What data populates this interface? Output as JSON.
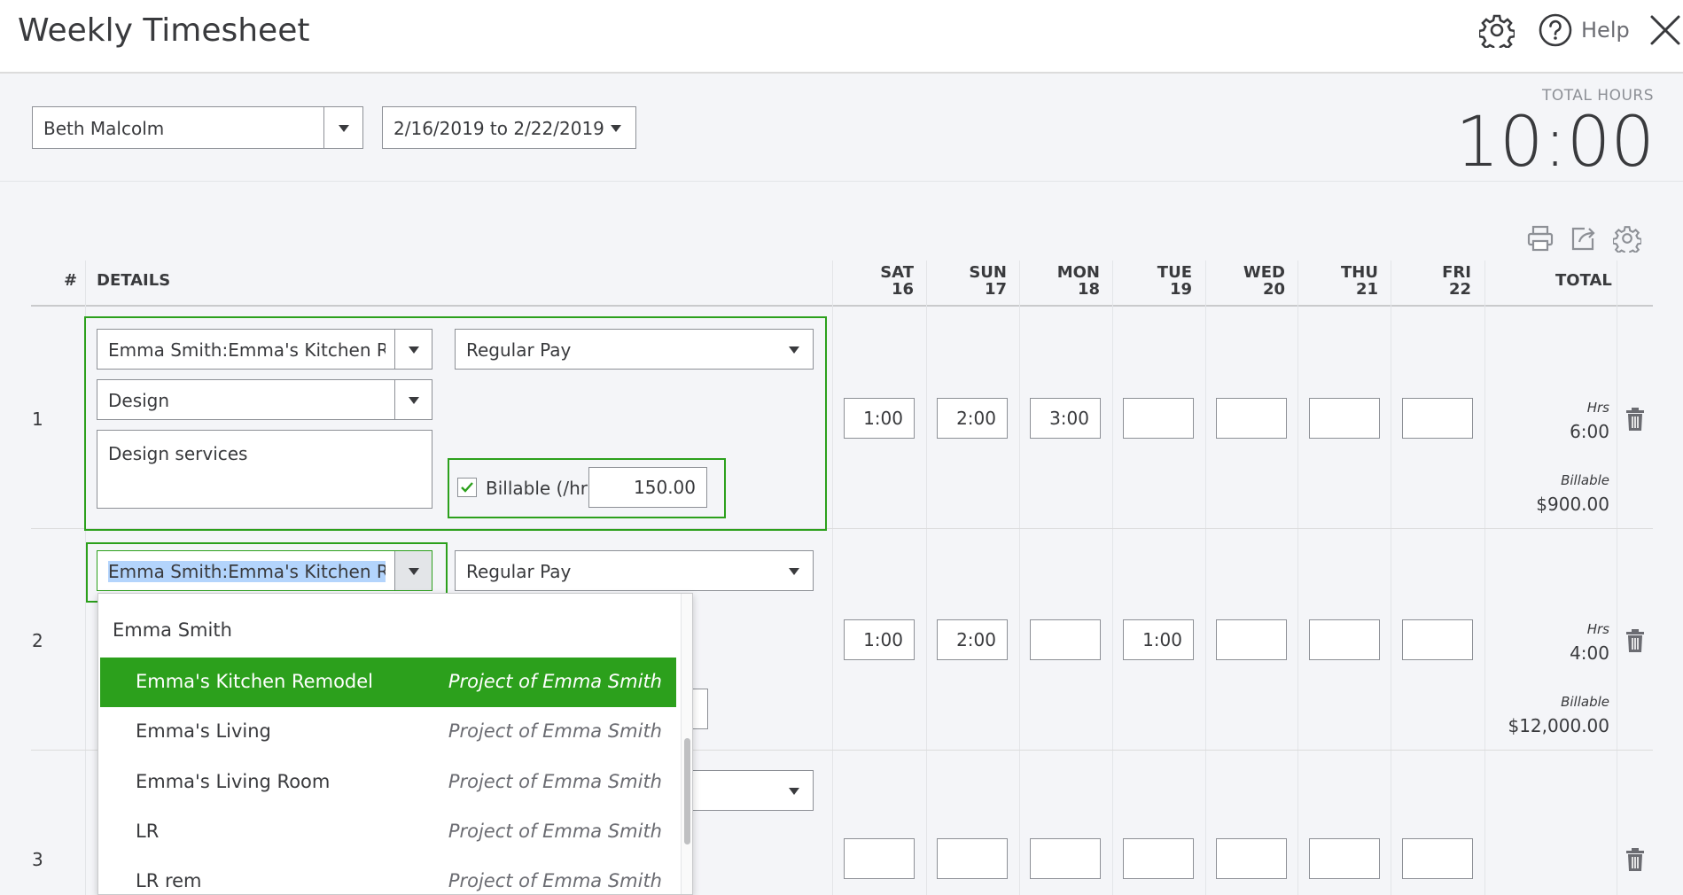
{
  "header": {
    "title": "Weekly Timesheet",
    "help_label": "Help"
  },
  "filters": {
    "employee": "Beth Malcolm",
    "date_range": "2/16/2019 to 2/22/2019"
  },
  "total_hours": {
    "label": "TOTAL HOURS",
    "value": "10:00"
  },
  "table": {
    "headers": {
      "num": "#",
      "details": "DETAILS",
      "total": "TOTAL"
    },
    "days": [
      {
        "dow": "SAT",
        "date": "16"
      },
      {
        "dow": "SUN",
        "date": "17"
      },
      {
        "dow": "MON",
        "date": "18"
      },
      {
        "dow": "TUE",
        "date": "19"
      },
      {
        "dow": "WED",
        "date": "20"
      },
      {
        "dow": "THU",
        "date": "21"
      },
      {
        "dow": "FRI",
        "date": "22"
      }
    ],
    "rows": [
      {
        "num": "1",
        "customer": "Emma Smith:Emma's Kitchen Remodel",
        "pay_type": "Regular Pay",
        "service": "Design",
        "description": "Design services",
        "billable_label": "Billable (/hr)",
        "rate": "150.00",
        "hours": [
          "1:00",
          "2:00",
          "3:00",
          "",
          "",
          "",
          ""
        ],
        "hrs_label": "Hrs",
        "total_hours": "6:00",
        "billable_total_label": "Billable",
        "billable_total": "$900.00"
      },
      {
        "num": "2",
        "customer": "Emma Smith:Emma's Kitchen Remodel",
        "pay_type": "Regular Pay",
        "hours": [
          "1:00",
          "2:00",
          "",
          "1:00",
          "",
          "",
          ""
        ],
        "hrs_label": "Hrs",
        "total_hours": "4:00",
        "billable_total_label": "Billable",
        "billable_total": "$12,000.00"
      },
      {
        "num": "3",
        "hours": [
          "",
          "",
          "",
          "",
          "",
          "",
          ""
        ]
      }
    ]
  },
  "dropdown": {
    "group_header": "Emma Smith",
    "items": [
      {
        "name": "Emma's Kitchen Remodel",
        "desc": "Project of Emma Smith",
        "active": true
      },
      {
        "name": "Emma's Living",
        "desc": "Project of Emma Smith",
        "active": false
      },
      {
        "name": "Emma's Living Room",
        "desc": "Project of Emma Smith",
        "active": false
      },
      {
        "name": "LR",
        "desc": "Project of Emma Smith",
        "active": false
      },
      {
        "name": "LR rem",
        "desc": "Project of Emma Smith",
        "active": false
      }
    ]
  },
  "colors": {
    "accent_green": "#2ca01c",
    "text": "#393a3d",
    "selection": "#b3d4fc"
  },
  "icons": [
    "gear-icon",
    "help-icon",
    "close-icon",
    "print-icon",
    "export-icon",
    "settings-icon",
    "chevron-down-icon",
    "trash-icon",
    "check-icon"
  ]
}
